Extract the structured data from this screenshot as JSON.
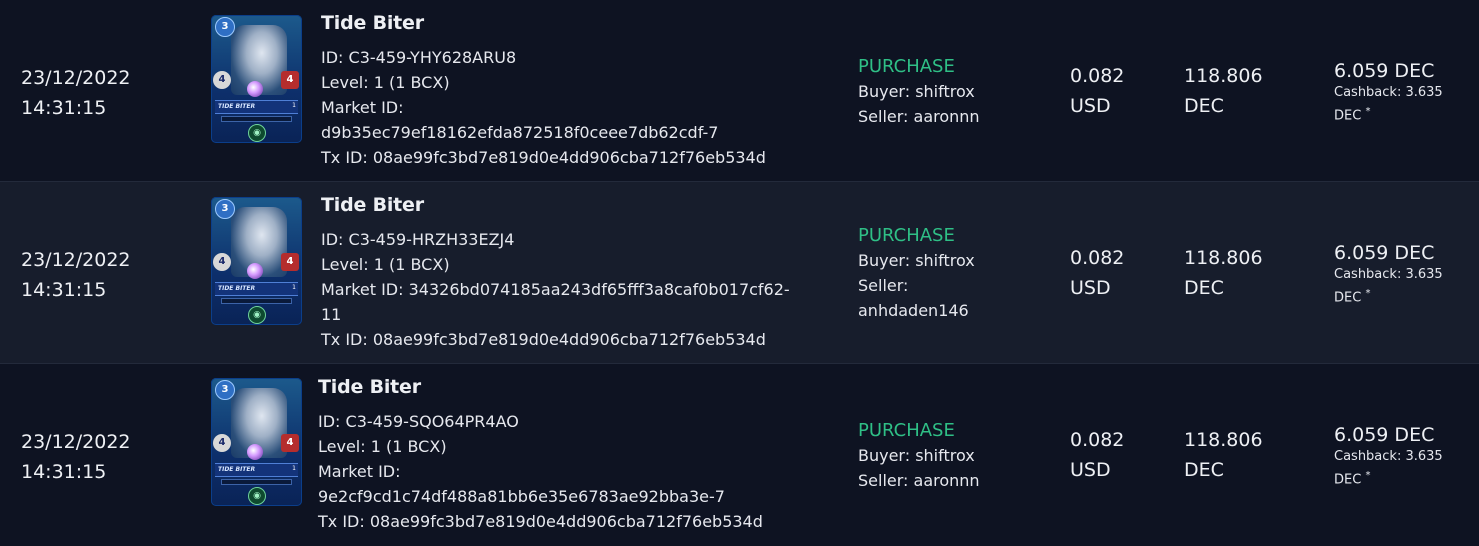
{
  "rows": [
    {
      "date": "23/12/2022",
      "time": "14:31:15",
      "card": {
        "mana": "3",
        "speed": "",
        "health": "4",
        "attack": "4",
        "nameplate": "TIDE BITER",
        "level": "1"
      },
      "name": "Tide Biter",
      "id_line": "ID: C3-459-YHY628ARU8",
      "level_line": "Level: 1 (1 BCX)",
      "market_line1": "Market ID:",
      "market_line2": "d9b35ec79ef18162efda872518f0ceee7db62cdf-7",
      "tx_line": "Tx ID: 08ae99fc3bd7e819d0e4dd906cba712f76eb534d",
      "type": "PURCHASE",
      "buyer_line": "Buyer: shiftrox",
      "seller_line1": "Seller: aaronnn",
      "seller_line2": "",
      "usd_value": "0.082",
      "usd_unit": "USD",
      "dec_value": "118.806",
      "dec_unit": "DEC",
      "fee": "6.059 DEC",
      "cashback": "Cashback: 3.635 DEC",
      "cashback_mark": "*"
    },
    {
      "date": "23/12/2022",
      "time": "14:31:15",
      "card": {
        "mana": "3",
        "speed": "",
        "health": "4",
        "attack": "4",
        "nameplate": "TIDE BITER",
        "level": "1"
      },
      "name": "Tide Biter",
      "id_line": "ID: C3-459-HRZH33EZJ4",
      "level_line": "Level: 1 (1 BCX)",
      "market_line1": "Market ID: 34326bd074185aa243df65fff3a8caf0b017cf62-",
      "market_line2": "11",
      "tx_line": "Tx ID: 08ae99fc3bd7e819d0e4dd906cba712f76eb534d",
      "type": "PURCHASE",
      "buyer_line": "Buyer: shiftrox",
      "seller_line1": "Seller:",
      "seller_line2": "anhdaden146",
      "usd_value": "0.082",
      "usd_unit": "USD",
      "dec_value": "118.806",
      "dec_unit": "DEC",
      "fee": "6.059 DEC",
      "cashback": "Cashback: 3.635 DEC",
      "cashback_mark": "*"
    },
    {
      "date": "23/12/2022",
      "time": "14:31:15",
      "card": {
        "mana": "3",
        "speed": "",
        "health": "4",
        "attack": "4",
        "nameplate": "TIDE BITER",
        "level": "1"
      },
      "name": "Tide Biter",
      "id_line": "ID: C3-459-SQO64PR4AO",
      "level_line": "Level: 1 (1 BCX)",
      "market_line1": "Market ID:",
      "market_line2": "9e2cf9cd1c74df488a81bb6e35e6783ae92bba3e-7",
      "tx_line": "Tx ID: 08ae99fc3bd7e819d0e4dd906cba712f76eb534d",
      "type": "PURCHASE",
      "buyer_line": "Buyer: shiftrox",
      "seller_line1": "Seller: aaronnn",
      "seller_line2": "",
      "usd_value": "0.082",
      "usd_unit": "USD",
      "dec_value": "118.806",
      "dec_unit": "DEC",
      "fee": "6.059 DEC",
      "cashback": "Cashback: 3.635 DEC",
      "cashback_mark": "*"
    }
  ],
  "colors": {
    "purchase": "#2fbf86",
    "background": "#0d1220",
    "row_alt": "#171d2c"
  }
}
